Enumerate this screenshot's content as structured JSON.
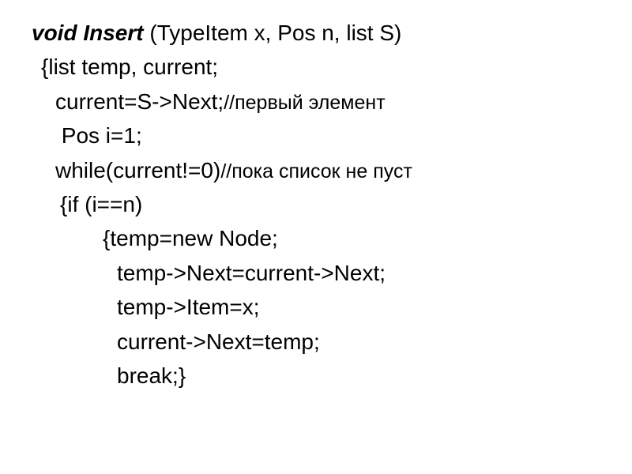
{
  "code": {
    "line1_sig_bold": "void Insert ",
    "line1_sig_params": "(TypeItem x, Pos n, list S)",
    "line2": "{list temp, current;",
    "line3_code": "current=S->Next;",
    "line3_comment": "//первый элемент",
    "line4": " Pos i=1;",
    "line5_code": "while(current!=0)",
    "line5_comment": "//пока список не пуст",
    "line6": "{if (i==n)",
    "line7": "{temp=new Node;",
    "line8": "temp->Next=current->Next;",
    "line9": "temp->Item=x;",
    "line10": "current->Next=temp;",
    "line11": "break;}"
  }
}
